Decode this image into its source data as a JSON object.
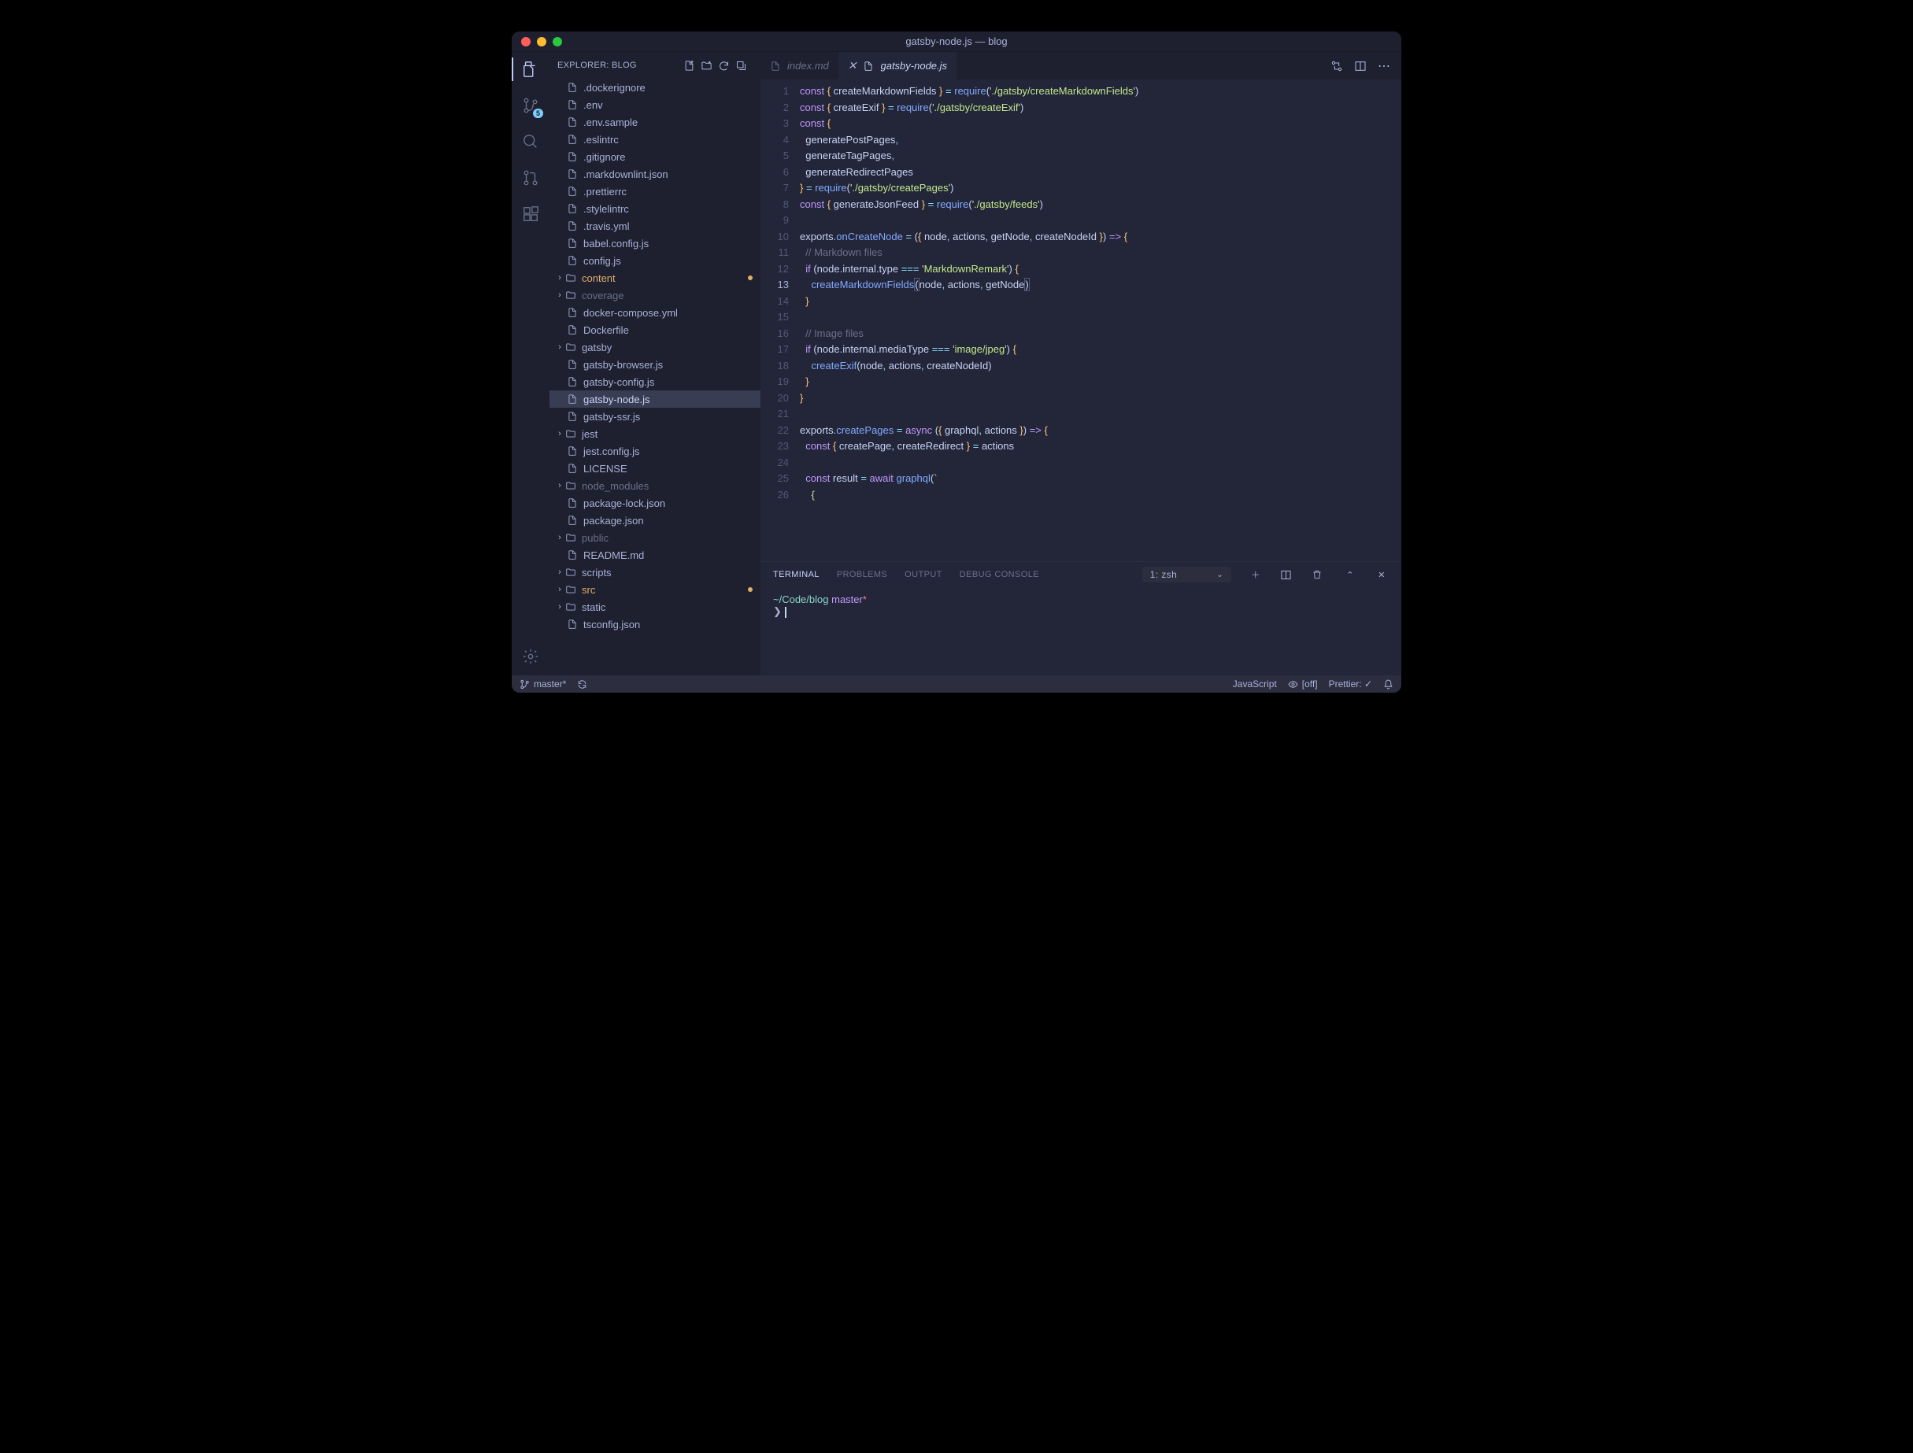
{
  "title": "gatsby-node.js — blog",
  "sidebar_title": "EXPLORER: BLOG",
  "scm_badge": "5",
  "tree": [
    {
      "icon": "file",
      "label": ".dockerignore"
    },
    {
      "icon": "file",
      "label": ".env"
    },
    {
      "icon": "file",
      "label": ".env.sample"
    },
    {
      "icon": "file",
      "label": ".eslintrc"
    },
    {
      "icon": "file",
      "label": ".gitignore"
    },
    {
      "icon": "file",
      "label": ".markdownlint.json"
    },
    {
      "icon": "file",
      "label": ".prettierrc"
    },
    {
      "icon": "file",
      "label": ".stylelintrc"
    },
    {
      "icon": "file",
      "label": ".travis.yml"
    },
    {
      "icon": "file",
      "label": "babel.config.js"
    },
    {
      "icon": "file",
      "label": "config.js"
    },
    {
      "icon": "folder",
      "label": "content",
      "chev": "›",
      "accent": true,
      "dot": true
    },
    {
      "icon": "folder",
      "label": "coverage",
      "chev": "›",
      "dim": true
    },
    {
      "icon": "file",
      "label": "docker-compose.yml"
    },
    {
      "icon": "file",
      "label": "Dockerfile"
    },
    {
      "icon": "folder",
      "label": "gatsby",
      "chev": "›"
    },
    {
      "icon": "file",
      "label": "gatsby-browser.js"
    },
    {
      "icon": "file",
      "label": "gatsby-config.js"
    },
    {
      "icon": "file",
      "label": "gatsby-node.js",
      "sel": true
    },
    {
      "icon": "file",
      "label": "gatsby-ssr.js"
    },
    {
      "icon": "folder",
      "label": "jest",
      "chev": "›"
    },
    {
      "icon": "file",
      "label": "jest.config.js"
    },
    {
      "icon": "file",
      "label": "LICENSE"
    },
    {
      "icon": "folder",
      "label": "node_modules",
      "chev": "›",
      "dim": true
    },
    {
      "icon": "file",
      "label": "package-lock.json"
    },
    {
      "icon": "file",
      "label": "package.json"
    },
    {
      "icon": "folder",
      "label": "public",
      "chev": "›",
      "dim": true
    },
    {
      "icon": "file",
      "label": "README.md"
    },
    {
      "icon": "folder",
      "label": "scripts",
      "chev": "›"
    },
    {
      "icon": "folder",
      "label": "src",
      "chev": "›",
      "accent": true,
      "dot": true
    },
    {
      "icon": "folder",
      "label": "static",
      "chev": "›"
    },
    {
      "icon": "file",
      "label": "tsconfig.json"
    }
  ],
  "tabs": [
    {
      "label": "index.md",
      "active": false
    },
    {
      "label": "gatsby-node.js",
      "active": true,
      "close": true
    }
  ],
  "lines": [
    1,
    2,
    3,
    4,
    5,
    6,
    7,
    8,
    9,
    10,
    11,
    12,
    13,
    14,
    15,
    16,
    17,
    18,
    19,
    20,
    21,
    22,
    23,
    24,
    25,
    26
  ],
  "current_line": 13,
  "code": [
    "<span class='kw'>const</span> <span class='br'>{</span> createMarkdownFields <span class='br'>}</span> <span class='op'>=</span> <span class='fn'>require</span>(<span class='str'>'./gatsby/createMarkdownFields'</span>)",
    "<span class='kw'>const</span> <span class='br'>{</span> createExif <span class='br'>}</span> <span class='op'>=</span> <span class='fn'>require</span>(<span class='str'>'./gatsby/createExif'</span>)",
    "<span class='kw'>const</span> <span class='br'>{</span>",
    "  generatePostPages<span class='op'>,</span>",
    "  generateTagPages<span class='op'>,</span>",
    "  generateRedirectPages",
    "<span class='br'>}</span> <span class='op'>=</span> <span class='fn'>require</span>(<span class='str'>'./gatsby/createPages'</span>)",
    "<span class='kw'>const</span> <span class='br'>{</span> generateJsonFeed <span class='br'>}</span> <span class='op'>=</span> <span class='fn'>require</span>(<span class='str'>'./gatsby/feeds'</span>)",
    "",
    "<span class='id'>exports</span><span class='op'>.</span><span class='fn'>onCreateNode</span> <span class='op'>=</span> (<span class='br'>{</span> node<span class='op'>,</span> actions<span class='op'>,</span> getNode<span class='op'>,</span> createNodeId <span class='br'>}</span>) <span class='kw'>=&gt;</span> <span class='br'>{</span>",
    "  <span class='cmt'>// Markdown files</span>",
    "  <span class='kw'>if</span> (node<span class='op'>.</span>internal<span class='op'>.</span>type <span class='op'>===</span> <span class='str'>'MarkdownRemark'</span>) <span class='br'>{</span>",
    "    <span class='fn'>createMarkdownFields</span><span style='border:1px solid #515879'>(</span>node<span class='op'>,</span> actions<span class='op'>,</span> getNode<span style='border:1px solid #515879'>)</span>",
    "  <span class='br'>}</span>",
    "",
    "  <span class='cmt'>// Image files</span>",
    "  <span class='kw'>if</span> (node<span class='op'>.</span>internal<span class='op'>.</span>mediaType <span class='op'>===</span> <span class='str'>'image/jpeg'</span>) <span class='br'>{</span>",
    "    <span class='fn'>createExif</span>(node<span class='op'>,</span> actions<span class='op'>,</span> createNodeId)",
    "  <span class='br'>}</span>",
    "<span class='br'>}</span>",
    "",
    "<span class='id'>exports</span><span class='op'>.</span><span class='fn'>createPages</span> <span class='op'>=</span> <span class='kw'>async</span> (<span class='br'>{</span> graphql<span class='op'>,</span> actions <span class='br'>}</span>) <span class='kw'>=&gt;</span> <span class='br'>{</span>",
    "  <span class='kw'>const</span> <span class='br'>{</span> createPage<span class='op'>,</span> createRedirect <span class='br'>}</span> <span class='op'>=</span> actions",
    "",
    "  <span class='kw'>const</span> result <span class='op'>=</span> <span class='kw'>await</span> <span class='fn'>graphql</span>(<span class='str'>`</span>",
    "    <span class='str'>{</span>"
  ],
  "panel": {
    "tabs": [
      "TERMINAL",
      "PROBLEMS",
      "OUTPUT",
      "DEBUG CONSOLE"
    ],
    "active": "TERMINAL",
    "term_select": "1: zsh",
    "term_path": "~/Code/blog",
    "term_branch": "master",
    "prompt_char": "❯"
  },
  "status": {
    "branch": "master*",
    "lang": "JavaScript",
    "eye": "[off]",
    "prettier": "Prettier: ✓"
  }
}
